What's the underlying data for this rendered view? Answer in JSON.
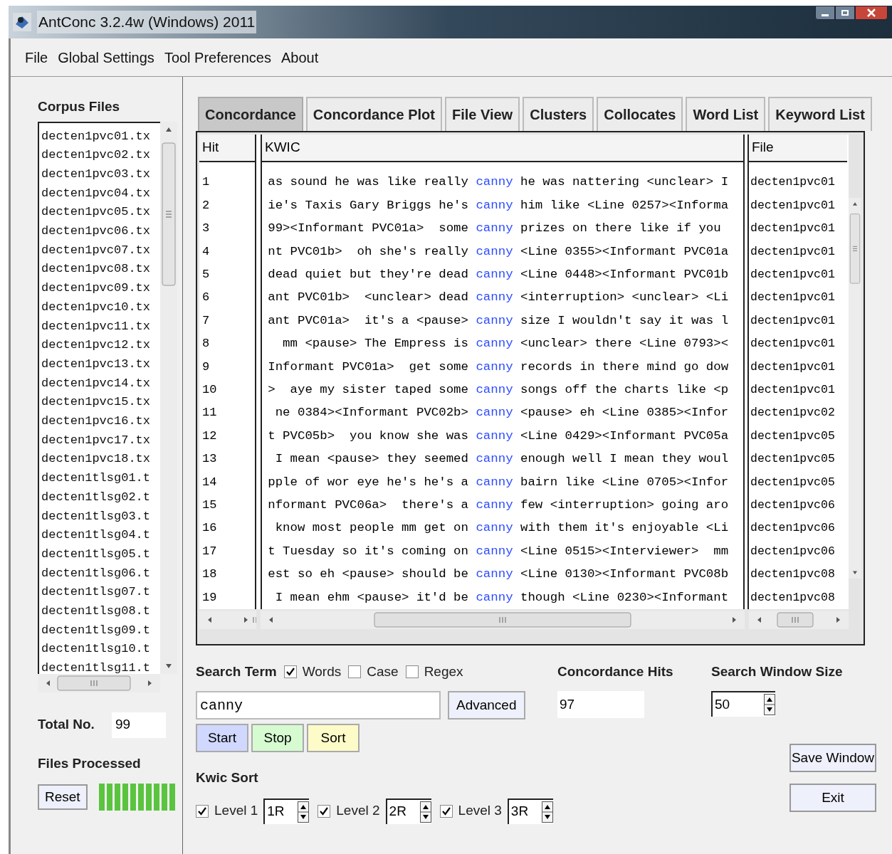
{
  "window": {
    "title": "AntConc 3.2.4w (Windows) 2011"
  },
  "menu": [
    "File",
    "Global Settings",
    "Tool Preferences",
    "About"
  ],
  "corpus_files": {
    "title": "Corpus Files",
    "files": [
      "decten1pvc01.tx",
      "decten1pvc02.tx",
      "decten1pvc03.tx",
      "decten1pvc04.tx",
      "decten1pvc05.tx",
      "decten1pvc06.tx",
      "decten1pvc07.tx",
      "decten1pvc08.tx",
      "decten1pvc09.tx",
      "decten1pvc10.tx",
      "decten1pvc11.tx",
      "decten1pvc12.tx",
      "decten1pvc13.tx",
      "decten1pvc14.tx",
      "decten1pvc15.tx",
      "decten1pvc16.tx",
      "decten1pvc17.tx",
      "decten1pvc18.tx",
      "decten1tlsg01.t",
      "decten1tlsg02.t",
      "decten1tlsg03.t",
      "decten1tlsg04.t",
      "decten1tlsg05.t",
      "decten1tlsg06.t",
      "decten1tlsg07.t",
      "decten1tlsg08.t",
      "decten1tlsg09.t",
      "decten1tlsg10.t",
      "decten1tlsg11.t"
    ]
  },
  "total": {
    "label": "Total No.",
    "value": "99"
  },
  "files_processed": {
    "label": "Files Processed",
    "reset": "Reset",
    "level": 1
  },
  "tabs": [
    {
      "label": "Concordance",
      "selected": true
    },
    {
      "label": "Concordance Plot",
      "selected": false
    },
    {
      "label": "File View",
      "selected": false
    },
    {
      "label": "Clusters",
      "selected": false
    },
    {
      "label": "Collocates",
      "selected": false
    },
    {
      "label": "Word List",
      "selected": false
    },
    {
      "label": "Keyword List",
      "selected": false
    }
  ],
  "table": {
    "columns": [
      "Hit",
      "KWIC",
      "File"
    ],
    "rows": [
      {
        "hit": "1",
        "left": "as sound he was like really",
        "node": "canny",
        "right": "he was nattering <unclear> I",
        "file": "decten1pvc01"
      },
      {
        "hit": "2",
        "left": "ie's Taxis Gary Briggs he's",
        "node": "canny",
        "right": "him like <Line 0257><Informa",
        "file": "decten1pvc01"
      },
      {
        "hit": "3",
        "left": "99><Informant PVC01a>  some",
        "node": "canny",
        "right": "prizes on there like if you",
        "file": "decten1pvc01"
      },
      {
        "hit": "4",
        "left": "nt PVC01b>  oh she's really",
        "node": "canny",
        "right": "<Line 0355><Informant PVC01a",
        "file": "decten1pvc01"
      },
      {
        "hit": "5",
        "left": "dead quiet but they're dead",
        "node": "canny",
        "right": "<Line 0448><Informant PVC01b",
        "file": "decten1pvc01"
      },
      {
        "hit": "6",
        "left": "ant PVC01b>  <unclear> dead",
        "node": "canny",
        "right": "<interruption> <unclear> <Li",
        "file": "decten1pvc01"
      },
      {
        "hit": "7",
        "left": "ant PVC01a>  it's a <pause>",
        "node": "canny",
        "right": "size I wouldn't say it was l",
        "file": "decten1pvc01"
      },
      {
        "hit": "8",
        "left": "mm <pause> The Empress is",
        "node": "canny",
        "right": "<unclear> there <Line 0793><",
        "file": "decten1pvc01"
      },
      {
        "hit": "9",
        "left": "Informant PVC01a>  get some",
        "node": "canny",
        "right": "records in there mind go dow",
        "file": "decten1pvc01"
      },
      {
        "hit": "10",
        "left": ">  aye my sister taped some",
        "node": "canny",
        "right": "songs off the charts like <p",
        "file": "decten1pvc01"
      },
      {
        "hit": "11",
        "left": "ne 0384><Informant PVC02b>",
        "node": "canny",
        "right": "<pause> eh <Line 0385><Infor",
        "file": "decten1pvc02"
      },
      {
        "hit": "12",
        "left": "t PVC05b>  you know she was",
        "node": "canny",
        "right": "<Line 0429><Informant PVC05a",
        "file": "decten1pvc05"
      },
      {
        "hit": "13",
        "left": "I mean <pause> they seemed",
        "node": "canny",
        "right": "enough well I mean they woul",
        "file": "decten1pvc05"
      },
      {
        "hit": "14",
        "left": "pple of wor eye he's he's a",
        "node": "canny",
        "right": "bairn like <Line 0705><Infor",
        "file": "decten1pvc05"
      },
      {
        "hit": "15",
        "left": "nformant PVC06a>  there's a",
        "node": "canny",
        "right": "few <interruption> going aro",
        "file": "decten1pvc06"
      },
      {
        "hit": "16",
        "left": "know most people mm get on",
        "node": "canny",
        "right": "with them it's enjoyable <Li",
        "file": "decten1pvc06"
      },
      {
        "hit": "17",
        "left": "t Tuesday so it's coming on",
        "node": "canny",
        "right": "<Line 0515><Interviewer>  mm",
        "file": "decten1pvc06"
      },
      {
        "hit": "18",
        "left": "est so eh <pause> should be",
        "node": "canny",
        "right": "<Line 0130><Informant PVC08b",
        "file": "decten1pvc08"
      },
      {
        "hit": "19",
        "left": "I mean ehm <pause> it'd be",
        "node": "canny",
        "right": "though <Line 0230><Informant",
        "file": "decten1pvc08"
      }
    ]
  },
  "search": {
    "label": "Search Term",
    "options": [
      {
        "label": "Words",
        "checked": true
      },
      {
        "label": "Case",
        "checked": false
      },
      {
        "label": "Regex",
        "checked": false
      }
    ],
    "value": "canny",
    "advanced": "Advanced"
  },
  "actions": [
    {
      "label": "Start",
      "color": "#d0d8ff"
    },
    {
      "label": "Stop",
      "color": "#d6fbd0"
    },
    {
      "label": "Sort",
      "color": "#fdfbc8"
    }
  ],
  "hits": {
    "label": "Concordance Hits",
    "value": "97"
  },
  "window_size": {
    "label": "Search Window Size",
    "value": "50"
  },
  "kwic_sort": {
    "label": "Kwic Sort",
    "levels": [
      {
        "label": "Level 1",
        "checked": true,
        "value": "1R"
      },
      {
        "label": "Level 2",
        "checked": true,
        "value": "2R"
      },
      {
        "label": "Level 3",
        "checked": true,
        "value": "3R"
      }
    ]
  },
  "buttons": [
    "Save Window",
    "Exit"
  ]
}
